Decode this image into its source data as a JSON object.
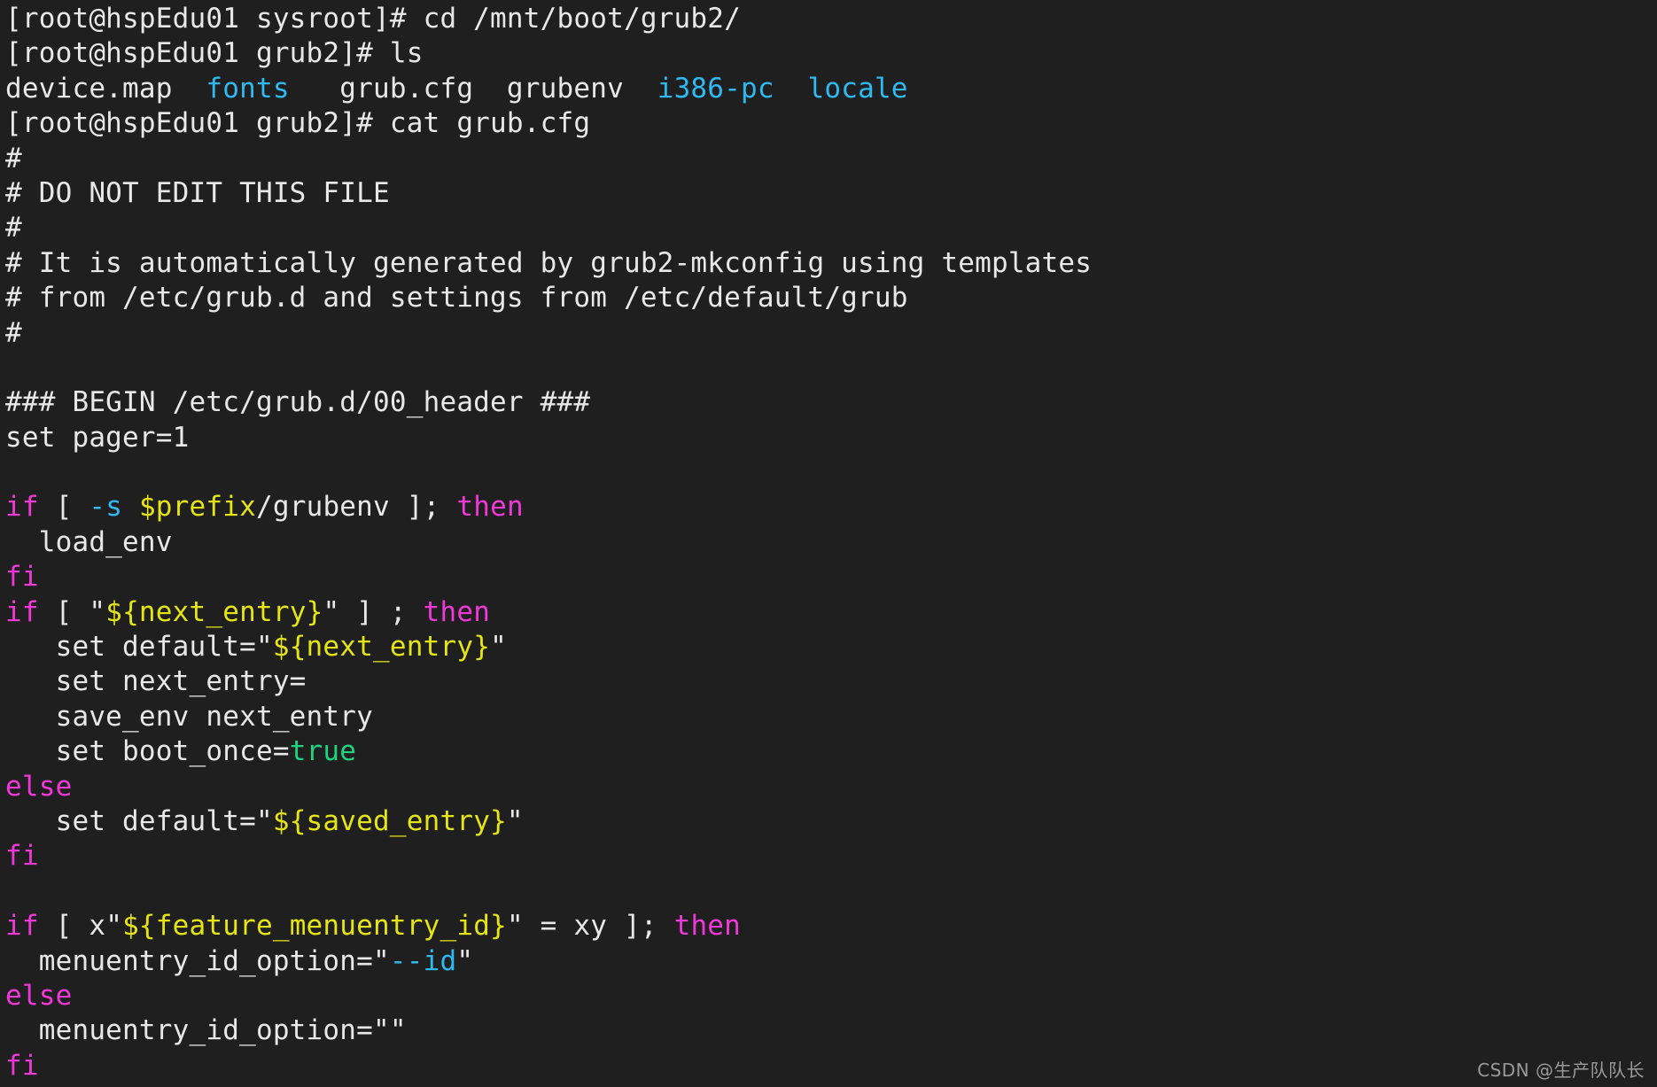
{
  "terminal": {
    "background_color": "#1f1f1f",
    "default_text_color": "#e8e8e8",
    "palette": {
      "directory_cyan": "#2fb9f2",
      "keyword_magenta": "#f038d8",
      "variable_yellow": "#e5e515",
      "option_cyan": "#2fb9f2",
      "value_green": "#1fd47e"
    },
    "lines": [
      {
        "id": "cmd-cd",
        "segments": [
          {
            "text": "[root@hspEdu01 sysroot]# cd /mnt/boot/grub2/",
            "color": "default"
          }
        ]
      },
      {
        "id": "cmd-ls",
        "segments": [
          {
            "text": "[root@hspEdu01 grub2]# ls",
            "color": "default"
          }
        ]
      },
      {
        "id": "ls-output",
        "segments": [
          {
            "text": "device.map  ",
            "color": "default"
          },
          {
            "text": "fonts",
            "color": "dir"
          },
          {
            "text": "   grub.cfg  grubenv  ",
            "color": "default"
          },
          {
            "text": "i386-pc",
            "color": "dir"
          },
          {
            "text": "  ",
            "color": "default"
          },
          {
            "text": "locale",
            "color": "dir"
          }
        ]
      },
      {
        "id": "cmd-cat",
        "segments": [
          {
            "text": "[root@hspEdu01 grub2]# cat grub.cfg",
            "color": "default"
          }
        ]
      },
      {
        "id": "comment-1",
        "segments": [
          {
            "text": "#",
            "color": "default"
          }
        ]
      },
      {
        "id": "comment-2",
        "segments": [
          {
            "text": "# DO NOT EDIT THIS FILE",
            "color": "default"
          }
        ]
      },
      {
        "id": "comment-3",
        "segments": [
          {
            "text": "#",
            "color": "default"
          }
        ]
      },
      {
        "id": "comment-4",
        "segments": [
          {
            "text": "# It is automatically generated by grub2-mkconfig using templates",
            "color": "default"
          }
        ]
      },
      {
        "id": "comment-5",
        "segments": [
          {
            "text": "# from /etc/grub.d and settings from /etc/default/grub",
            "color": "default"
          }
        ]
      },
      {
        "id": "comment-6",
        "segments": [
          {
            "text": "#",
            "color": "default"
          }
        ]
      },
      {
        "id": "blank-1",
        "segments": [
          {
            "text": " ",
            "color": "default"
          }
        ]
      },
      {
        "id": "begin-header",
        "segments": [
          {
            "text": "### BEGIN /etc/grub.d/00_header ###",
            "color": "default"
          }
        ]
      },
      {
        "id": "set-pager",
        "segments": [
          {
            "text": "set pager=1",
            "color": "default"
          }
        ]
      },
      {
        "id": "blank-2",
        "segments": [
          {
            "text": " ",
            "color": "default"
          }
        ]
      },
      {
        "id": "if-prefix-grubenv",
        "segments": [
          {
            "text": "if",
            "color": "key"
          },
          {
            "text": " [ ",
            "color": "default"
          },
          {
            "text": "-s",
            "color": "cyan"
          },
          {
            "text": " ",
            "color": "default"
          },
          {
            "text": "$prefix",
            "color": "var"
          },
          {
            "text": "/grubenv ]; ",
            "color": "default"
          },
          {
            "text": "then",
            "color": "key"
          }
        ]
      },
      {
        "id": "load-env",
        "segments": [
          {
            "text": "  load_env",
            "color": "default"
          }
        ]
      },
      {
        "id": "fi-1",
        "segments": [
          {
            "text": "fi",
            "color": "key"
          }
        ]
      },
      {
        "id": "if-next-entry",
        "segments": [
          {
            "text": "if",
            "color": "key"
          },
          {
            "text": " [ \"",
            "color": "default"
          },
          {
            "text": "${next_entry}",
            "color": "var"
          },
          {
            "text": "\" ] ; ",
            "color": "default"
          },
          {
            "text": "then",
            "color": "key"
          }
        ]
      },
      {
        "id": "set-default-next",
        "segments": [
          {
            "text": "   set default=\"",
            "color": "default"
          },
          {
            "text": "${next_entry}",
            "color": "var"
          },
          {
            "text": "\"",
            "color": "default"
          }
        ]
      },
      {
        "id": "set-next-entry",
        "segments": [
          {
            "text": "   set next_entry=",
            "color": "default"
          }
        ]
      },
      {
        "id": "save-env-next",
        "segments": [
          {
            "text": "   save_env next_entry",
            "color": "default"
          }
        ]
      },
      {
        "id": "set-boot-once",
        "segments": [
          {
            "text": "   set boot_once=",
            "color": "default"
          },
          {
            "text": "true",
            "color": "green"
          }
        ]
      },
      {
        "id": "else-1",
        "segments": [
          {
            "text": "else",
            "color": "key"
          }
        ]
      },
      {
        "id": "set-default-saved",
        "segments": [
          {
            "text": "   set default=\"",
            "color": "default"
          },
          {
            "text": "${saved_entry}",
            "color": "var"
          },
          {
            "text": "\"",
            "color": "default"
          }
        ]
      },
      {
        "id": "fi-2",
        "segments": [
          {
            "text": "fi",
            "color": "key"
          }
        ]
      },
      {
        "id": "blank-3",
        "segments": [
          {
            "text": " ",
            "color": "default"
          }
        ]
      },
      {
        "id": "if-feature-menuentry-id",
        "segments": [
          {
            "text": "if",
            "color": "key"
          },
          {
            "text": " [ x\"",
            "color": "default"
          },
          {
            "text": "${feature_menuentry_id}",
            "color": "var"
          },
          {
            "text": "\" = xy ]; ",
            "color": "default"
          },
          {
            "text": "then",
            "color": "key"
          }
        ]
      },
      {
        "id": "menuentry-id-option-id",
        "segments": [
          {
            "text": "  menuentry_id_option=\"",
            "color": "default"
          },
          {
            "text": "--id",
            "color": "cyan"
          },
          {
            "text": "\"",
            "color": "default"
          }
        ]
      },
      {
        "id": "else-2",
        "segments": [
          {
            "text": "else",
            "color": "key"
          }
        ]
      },
      {
        "id": "menuentry-id-option-empty",
        "segments": [
          {
            "text": "  menuentry_id_option=\"\"",
            "color": "default"
          }
        ]
      },
      {
        "id": "fi-3",
        "segments": [
          {
            "text": "fi",
            "color": "key"
          }
        ]
      }
    ]
  },
  "watermark": {
    "text": "CSDN @生产队队长"
  }
}
